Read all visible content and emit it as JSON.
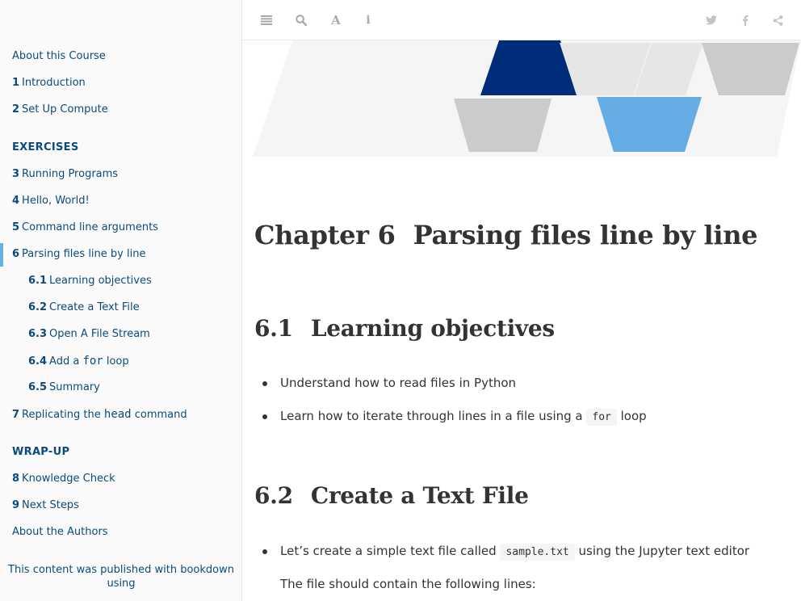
{
  "sidebar": {
    "about_course": "About this Course",
    "items": [
      {
        "num": "1",
        "label": "Introduction"
      },
      {
        "num": "2",
        "label": "Set Up Compute"
      }
    ],
    "exercises_header": "EXERCISES",
    "exercise_items": [
      {
        "num": "3",
        "label": "Running Programs"
      },
      {
        "num": "4",
        "label": "Hello, World!"
      },
      {
        "num": "5",
        "label": "Command line arguments"
      },
      {
        "num": "6",
        "label": "Parsing files line by line"
      }
    ],
    "sub_items": [
      {
        "num": "6.1",
        "label": "Learning objectives"
      },
      {
        "num": "6.2",
        "label": "Create a Text File"
      },
      {
        "num": "6.3",
        "label": "Open A File Stream"
      },
      {
        "num": "6.4",
        "label_pre": "Add a ",
        "code": "for",
        "label_post": " loop"
      },
      {
        "num": "6.5",
        "label": "Summary"
      }
    ],
    "item7": {
      "num": "7",
      "label_pre": "Replicating the ",
      "code": "head",
      "label_post": " command"
    },
    "wrapup_header": "WRAP-UP",
    "wrapup_items": [
      {
        "num": "8",
        "label": "Knowledge Check"
      },
      {
        "num": "9",
        "label": "Next Steps"
      }
    ],
    "about_authors": "About the Authors",
    "published_line1": "This content was published with bookdown",
    "published_line2": "using"
  },
  "toolbar": {
    "icons_left": [
      "menu-icon",
      "search-icon",
      "font-icon",
      "info-icon"
    ],
    "icons_right": [
      "twitter-icon",
      "facebook-icon",
      "share-icon"
    ]
  },
  "content": {
    "chapter_num": "Chapter 6",
    "chapter_title": "Parsing files line by line",
    "section1_num": "6.1",
    "section1_title": "Learning objectives",
    "objectives": [
      {
        "text": "Understand how to read files in Python"
      },
      {
        "pre": "Learn how to iterate through lines in a file using a ",
        "code": "for",
        "post": " loop"
      }
    ],
    "section2_num": "6.2",
    "section2_title": "Create a Text File",
    "create_pre": "Let’s create a simple text file called ",
    "create_code": "sample.txt",
    "create_post": " using the Jupyter text editor",
    "contain_text": "The file should contain the following lines:"
  },
  "colors": {
    "link": "#0b4b7c",
    "accent_bar": "#68b0e4",
    "banner_navy": "#002c7a",
    "banner_blue": "#65abe4",
    "banner_grey": "#cbcbcb",
    "banner_light": "#e6e6e6"
  }
}
